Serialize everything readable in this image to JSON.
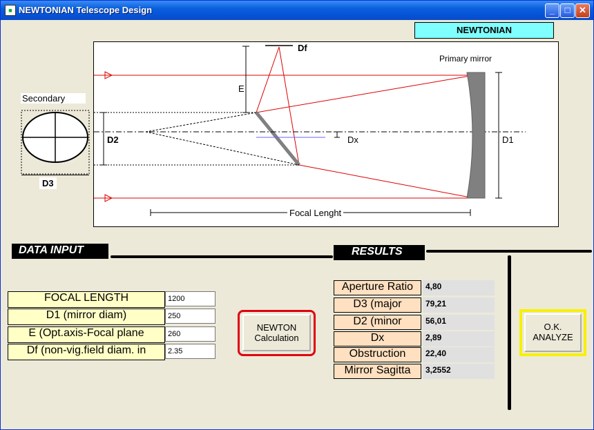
{
  "window": {
    "title": "NEWTONIAN Telescope Design"
  },
  "header": {
    "badge": "NEWTONIAN"
  },
  "diagram": {
    "secondary_label": "Secondary",
    "d3_label": "D3",
    "primary_label": "Primary mirror",
    "e_label": "E",
    "df_label": "Df",
    "d2_label": "D2",
    "dx_label": "Dx",
    "d1_label": "D1",
    "focal_label": "Focal Lenght"
  },
  "data_input": {
    "header": "DATA INPUT",
    "fields": [
      {
        "label": "FOCAL LENGTH",
        "value": "1200"
      },
      {
        "label": "D1  (mirror diam)",
        "value": "250"
      },
      {
        "label": "E (Opt.axis-Focal plane",
        "value": "260"
      },
      {
        "label": "Df  (non-vig.field diam. in",
        "value": "2.35"
      }
    ]
  },
  "calc_button": {
    "label_line1": "NEWTON",
    "label_line2": "Calculation"
  },
  "results": {
    "header": "RESULTS",
    "rows": [
      {
        "label": "Aperture Ratio",
        "value": "4,80"
      },
      {
        "label": "D3 (major",
        "value": "79,21"
      },
      {
        "label": "D2 (minor",
        "value": "56,01"
      },
      {
        "label": "Dx",
        "value": "2,89"
      },
      {
        "label": "Obstruction",
        "value": "22,40"
      },
      {
        "label": "Mirror Sagitta",
        "value": "3,2552"
      }
    ]
  },
  "analyze_button": {
    "label_line1": "O.K.",
    "label_line2": "ANALYZE"
  }
}
